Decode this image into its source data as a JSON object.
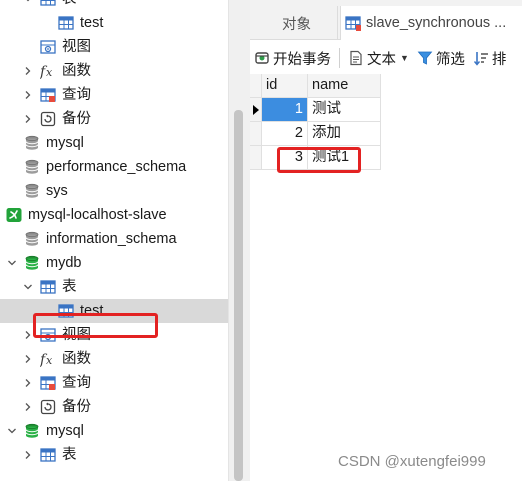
{
  "tree": {
    "items": [
      {
        "label": "表",
        "icon": "table-folder-icon",
        "chevron": "down"
      },
      {
        "label": "test",
        "icon": "table-icon",
        "chevron": ""
      },
      {
        "label": "视图",
        "icon": "view-icon",
        "chevron": ""
      },
      {
        "label": "函数",
        "icon": "function-icon",
        "chevron": "right"
      },
      {
        "label": "查询",
        "icon": "query-icon",
        "chevron": "right"
      },
      {
        "label": "备份",
        "icon": "backup-icon",
        "chevron": "right"
      },
      {
        "label": "mysql",
        "icon": "database-icon",
        "chevron": ""
      },
      {
        "label": "performance_schema",
        "icon": "database-icon",
        "chevron": ""
      },
      {
        "label": "sys",
        "icon": "database-icon",
        "chevron": ""
      },
      {
        "label": "mysql-localhost-slave",
        "icon": "connection-icon",
        "chevron": ""
      },
      {
        "label": "information_schema",
        "icon": "database-icon",
        "chevron": ""
      },
      {
        "label": "mydb",
        "icon": "database-open-icon",
        "chevron": "down"
      },
      {
        "label": "表",
        "icon": "table-folder-icon",
        "chevron": "down"
      },
      {
        "label": "test",
        "icon": "table-icon",
        "chevron": "",
        "selected": true
      },
      {
        "label": "视图",
        "icon": "view-icon",
        "chevron": "right"
      },
      {
        "label": "函数",
        "icon": "function-icon",
        "chevron": "right"
      },
      {
        "label": "查询",
        "icon": "query-icon",
        "chevron": "right"
      },
      {
        "label": "备份",
        "icon": "backup-icon",
        "chevron": "right"
      },
      {
        "label": "mysql",
        "icon": "database-open-icon",
        "chevron": "down"
      },
      {
        "label": "表",
        "icon": "table-folder-icon",
        "chevron": "right"
      }
    ]
  },
  "tabs": {
    "objects_label": "对象",
    "table_label": "slave_synchronous ..."
  },
  "toolbar": {
    "begin_transaction": "开始事务",
    "text": "文本",
    "filter": "筛选",
    "sort": "排"
  },
  "grid": {
    "columns": [
      "id",
      "name"
    ],
    "rows": [
      {
        "id": "1",
        "name": "测试"
      },
      {
        "id": "2",
        "name": "添加"
      },
      {
        "id": "3",
        "name": "测试1"
      }
    ],
    "active_row": 0
  },
  "watermark": "CSDN @xutengfei999",
  "colors": {
    "highlight": "#e32222",
    "active_cell": "#3c8de0",
    "selection": "#d9d9d9",
    "db_green": "#23a33a",
    "table_blue": "#3a74c4"
  }
}
